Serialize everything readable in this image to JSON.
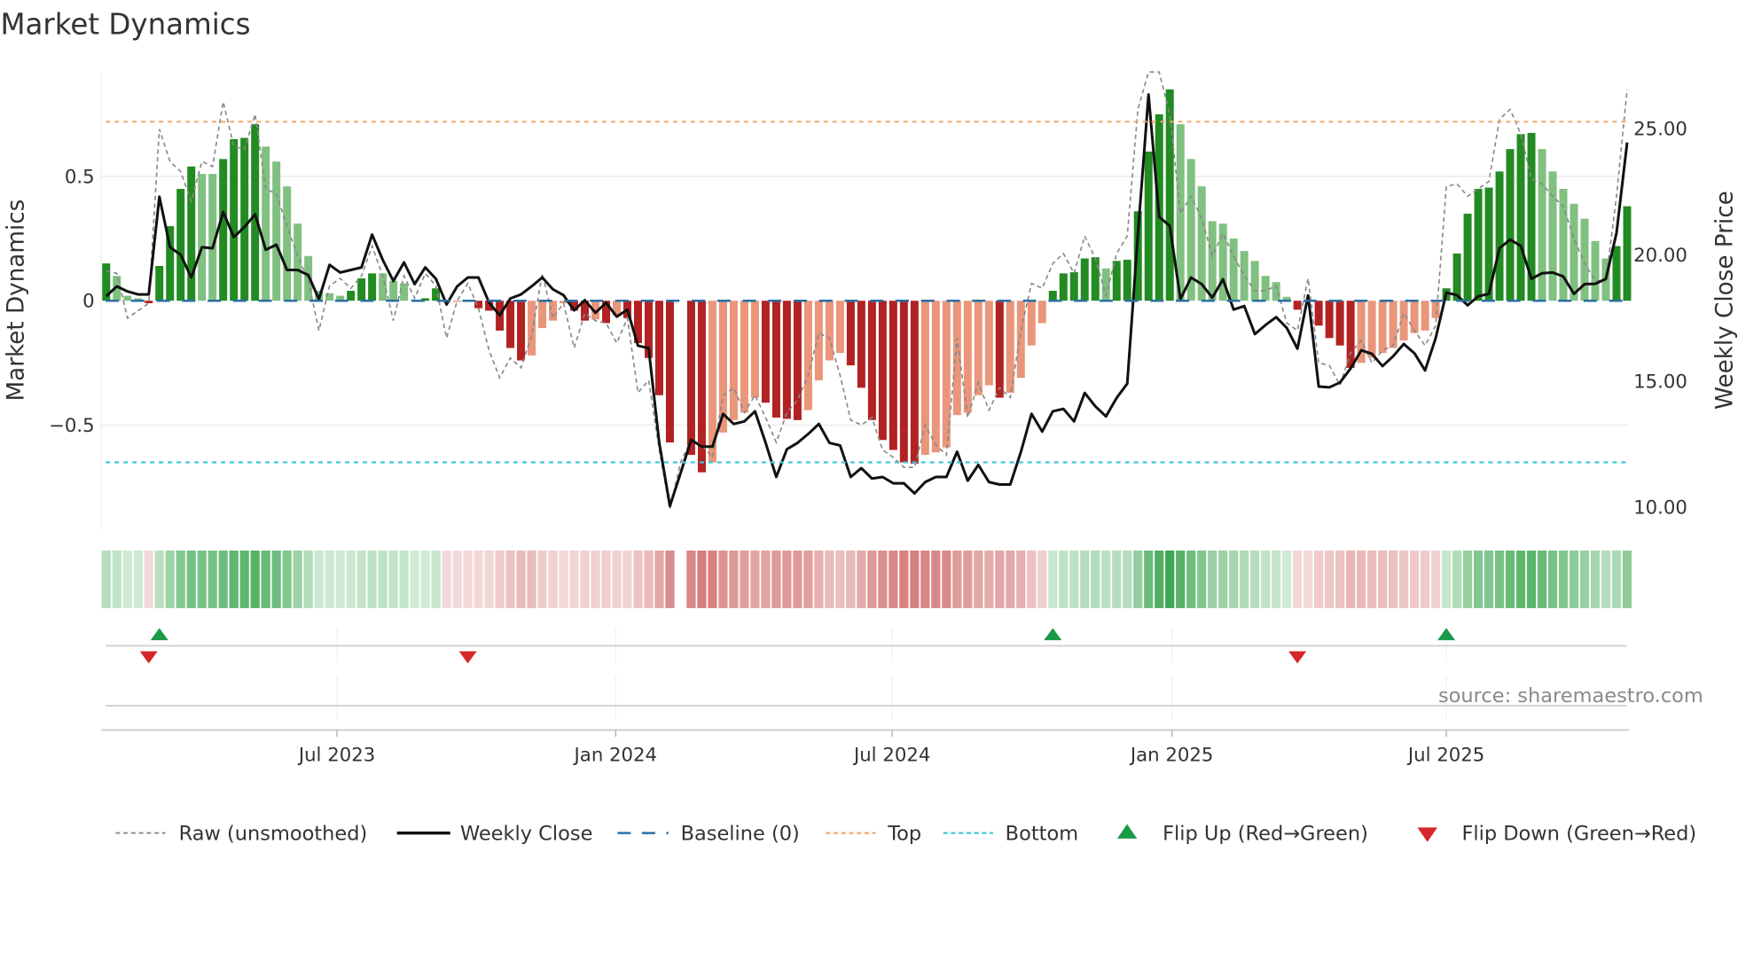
{
  "chart_data": {
    "type": "bar",
    "title": "Market Dynamics",
    "ylabel": "Market Dynamics",
    "y2label": "Weekly Close Price",
    "ylim": [
      -0.92,
      0.92
    ],
    "y2lim": [
      9.12,
      27.24
    ],
    "yticks": [
      {
        "value": 0.5,
        "label": "0.5"
      },
      {
        "value": 0,
        "label": "0"
      },
      {
        "value": -0.5,
        "label": "−0.5"
      }
    ],
    "y2ticks": [
      {
        "value": 25,
        "label": "25.00"
      },
      {
        "value": 20,
        "label": "20.00"
      },
      {
        "value": 15,
        "label": "15.00"
      },
      {
        "value": 10,
        "label": "10.00"
      }
    ],
    "x_unit": "week index",
    "xticks": [
      {
        "week": 21.7,
        "label": "Jul 2023"
      },
      {
        "week": 47.9,
        "label": "Jan 2024"
      },
      {
        "week": 73.9,
        "label": "Jul 2024"
      },
      {
        "week": 100.2,
        "label": "Jan 2025"
      },
      {
        "week": 126.0,
        "label": "Jul 2025"
      }
    ],
    "top_level": 0.72,
    "bottom_level": -0.65,
    "baseline": 0,
    "series": [
      {
        "name": "Market Dynamics (smoothed)",
        "type": "bar",
        "values": [
          0.15,
          0.1,
          0.02,
          0.01,
          -0.01,
          0.14,
          0.3,
          0.45,
          0.54,
          0.51,
          0.51,
          0.57,
          0.65,
          0.655,
          0.71,
          0.62,
          0.56,
          0.46,
          0.31,
          0.18,
          0.04,
          0.03,
          0.02,
          0.04,
          0.09,
          0.11,
          0.11,
          0.08,
          0.07,
          0.004,
          0.01,
          0.05,
          -0.005,
          -0.005,
          -0.005,
          -0.03,
          -0.04,
          -0.12,
          -0.19,
          -0.24,
          -0.22,
          -0.11,
          -0.08,
          -0.01,
          -0.04,
          -0.08,
          -0.075,
          -0.09,
          -0.06,
          -0.07,
          -0.17,
          -0.23,
          -0.38,
          -0.57,
          null,
          -0.62,
          -0.69,
          -0.65,
          -0.53,
          -0.48,
          -0.45,
          -0.39,
          -0.41,
          -0.47,
          -0.475,
          -0.48,
          -0.44,
          -0.32,
          -0.24,
          -0.21,
          -0.26,
          -0.35,
          -0.48,
          -0.56,
          -0.6,
          -0.65,
          -0.655,
          -0.62,
          -0.61,
          -0.59,
          -0.46,
          -0.45,
          -0.38,
          -0.34,
          -0.39,
          -0.37,
          -0.31,
          -0.18,
          -0.09,
          0.04,
          0.11,
          0.115,
          0.17,
          0.175,
          0.13,
          0.16,
          0.165,
          0.36,
          0.6,
          0.75,
          0.85,
          0.71,
          0.57,
          0.46,
          0.32,
          0.31,
          0.25,
          0.2,
          0.16,
          0.1,
          0.075,
          0.016,
          -0.036,
          -0.005,
          -0.1,
          -0.15,
          -0.18,
          -0.27,
          -0.25,
          -0.23,
          -0.21,
          -0.19,
          -0.16,
          -0.13,
          -0.12,
          -0.07,
          0.05,
          0.19,
          0.35,
          0.45,
          0.455,
          0.52,
          0.61,
          0.67,
          0.675,
          0.61,
          0.52,
          0.45,
          0.39,
          0.33,
          0.24,
          0.17,
          0.22,
          0.38
        ]
      },
      {
        "name": "Raw (unsmoothed)",
        "type": "line",
        "values": [
          0.12,
          0.11,
          -0.07,
          -0.04,
          -0.01,
          0.69,
          0.56,
          0.52,
          0.4,
          0.56,
          0.54,
          0.8,
          0.62,
          0.61,
          0.75,
          0.45,
          0.43,
          0.3,
          0.18,
          0.08,
          -0.12,
          0.06,
          0.09,
          0.05,
          0.1,
          0.22,
          0.1,
          -0.08,
          0.1,
          0.01,
          0.11,
          0.06,
          -0.15,
          0.0,
          0.07,
          -0.03,
          -0.2,
          -0.31,
          -0.23,
          -0.27,
          -0.14,
          0.11,
          -0.07,
          -0.01,
          -0.19,
          -0.05,
          -0.08,
          -0.09,
          -0.17,
          -0.07,
          -0.37,
          -0.32,
          -0.6,
          -0.84,
          -0.65,
          -0.56,
          -0.58,
          -0.63,
          -0.38,
          -0.35,
          -0.45,
          -0.38,
          -0.47,
          -0.57,
          -0.45,
          -0.4,
          -0.3,
          -0.13,
          -0.15,
          -0.3,
          -0.48,
          -0.5,
          -0.47,
          -0.6,
          -0.63,
          -0.67,
          -0.67,
          -0.5,
          -0.58,
          -0.62,
          -0.15,
          -0.47,
          -0.33,
          -0.44,
          -0.35,
          -0.39,
          -0.12,
          0.07,
          0.05,
          0.15,
          0.19,
          0.11,
          0.26,
          0.17,
          0.02,
          0.19,
          0.26,
          0.77,
          0.92,
          0.92,
          0.75,
          0.35,
          0.42,
          0.33,
          0.18,
          0.27,
          0.18,
          0.1,
          0.04,
          0.04,
          0.06,
          -0.09,
          -0.12,
          0.09,
          -0.25,
          -0.26,
          -0.34,
          -0.21,
          -0.16,
          -0.25,
          -0.2,
          -0.18,
          -0.05,
          -0.12,
          -0.18,
          -0.1,
          0.46,
          0.47,
          0.42,
          0.45,
          0.48,
          0.73,
          0.77,
          0.67,
          0.49,
          0.47,
          0.42,
          0.38,
          0.25,
          0.15,
          0.08,
          0.08,
          0.42,
          0.85
        ]
      },
      {
        "name": "Weekly Close",
        "type": "line",
        "axis": "right",
        "values": [
          18.36,
          18.75,
          18.55,
          18.43,
          18.43,
          22.3,
          20.3,
          20.0,
          19.1,
          20.3,
          20.26,
          21.7,
          20.7,
          21.1,
          21.6,
          20.2,
          20.4,
          19.4,
          19.4,
          19.2,
          18.24,
          19.6,
          19.3,
          19.4,
          19.5,
          20.8,
          19.8,
          18.96,
          19.7,
          18.84,
          19.5,
          19.05,
          18.03,
          18.75,
          19.1,
          19.1,
          18.1,
          17.6,
          18.27,
          18.43,
          18.75,
          19.1,
          18.63,
          18.4,
          17.8,
          18.2,
          17.7,
          18.1,
          17.55,
          17.83,
          16.4,
          16.3,
          12.55,
          10.05,
          11.35,
          12.67,
          12.4,
          12.4,
          13.7,
          13.3,
          13.4,
          13.8,
          12.55,
          11.2,
          12.3,
          12.55,
          12.9,
          13.3,
          12.55,
          12.45,
          11.2,
          11.55,
          11.14,
          11.2,
          10.95,
          10.95,
          10.55,
          11.0,
          11.2,
          11.2,
          12.2,
          11.05,
          11.68,
          11.0,
          10.9,
          10.9,
          12.19,
          13.7,
          13.0,
          13.8,
          13.9,
          13.4,
          14.53,
          14.0,
          13.6,
          14.33,
          14.9,
          20.8,
          26.35,
          21.5,
          21.14,
          18.24,
          19.1,
          18.84,
          18.3,
          19.03,
          17.83,
          17.97,
          16.86,
          17.22,
          17.53,
          17.1,
          16.28,
          18.39,
          14.78,
          14.75,
          14.94,
          15.5,
          16.22,
          16.08,
          15.59,
          15.98,
          16.47,
          16.1,
          15.42,
          16.7,
          18.5,
          18.4,
          18.0,
          18.36,
          18.45,
          20.26,
          20.6,
          20.35,
          19.05,
          19.27,
          19.3,
          19.14,
          18.45,
          18.84,
          18.85,
          19.05,
          20.86,
          24.45
        ]
      }
    ],
    "flips": {
      "up_weeks": [
        5,
        89,
        126
      ],
      "down_weeks": [
        4,
        34,
        112
      ]
    },
    "legend": {
      "placement": "bottom",
      "items": [
        {
          "key": "raw",
          "label": "Raw (unsmoothed)"
        },
        {
          "key": "close",
          "label": "Weekly Close"
        },
        {
          "key": "baseline",
          "label": "Baseline (0)"
        },
        {
          "key": "top",
          "label": "Top"
        },
        {
          "key": "bottom",
          "label": "Bottom"
        },
        {
          "key": "flip_up",
          "label": "Flip Up (Red→Green)"
        },
        {
          "key": "flip_down",
          "label": "Flip Down (Green→Red)"
        }
      ]
    },
    "colors": {
      "green_strong": "#228b22",
      "green_weak": "#80c080",
      "red_strong": "#b22222",
      "red_weak": "#e9967a",
      "close": "#111111",
      "raw": "#888888",
      "baseline": "#2a6fa3",
      "top": "#f0a868",
      "bottom": "#3cc8dc",
      "flip_up": "#1a9a48",
      "flip_down": "#d62728"
    }
  },
  "source": "source: sharemaestro.com"
}
